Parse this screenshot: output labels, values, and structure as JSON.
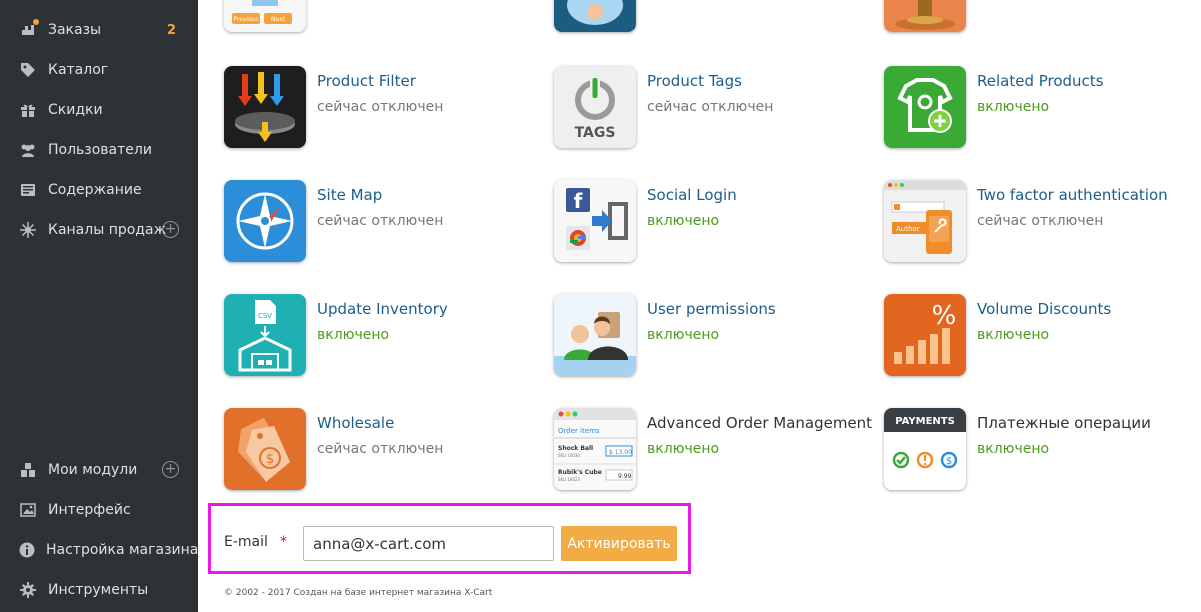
{
  "sidebar": {
    "items": [
      {
        "label": "Заказы",
        "icon": "orders-icon",
        "badge": "2"
      },
      {
        "label": "Каталог",
        "icon": "tag-icon"
      },
      {
        "label": "Скидки",
        "icon": "gift-icon"
      },
      {
        "label": "Пользователи",
        "icon": "users-icon"
      },
      {
        "label": "Содержание",
        "icon": "content-icon"
      },
      {
        "label": "Каналы продаж",
        "icon": "channels-icon"
      }
    ],
    "bottom_items": [
      {
        "label": "Мои модули",
        "icon": "modules-icon"
      },
      {
        "label": "Интерфейс",
        "icon": "image-icon"
      },
      {
        "label": "Настройка магазина",
        "icon": "info-icon"
      },
      {
        "label": "Инструменты",
        "icon": "gear-icon"
      }
    ]
  },
  "top_partial_tiles": {
    "pager_previous": "Previous",
    "pager_next": "Next"
  },
  "modules": [
    {
      "name": "Product Filter",
      "status": "сейчас отключен",
      "enabled": false,
      "icon": "product-filter-icon"
    },
    {
      "name": "Product Tags",
      "status": "сейчас отключен",
      "enabled": false,
      "icon": "product-tags-icon",
      "icon_text": "TAGS"
    },
    {
      "name": "Related Products",
      "status": "включено",
      "enabled": true,
      "icon": "related-products-icon"
    },
    {
      "name": "Site Map",
      "status": "сейчас отключен",
      "enabled": false,
      "icon": "compass-icon"
    },
    {
      "name": "Social Login",
      "status": "включено",
      "enabled": true,
      "icon": "social-login-icon"
    },
    {
      "name": "Two factor authentication",
      "status": "сейчас отключен",
      "enabled": false,
      "icon": "two-factor-icon",
      "icon_text": "Author"
    },
    {
      "name": "Update Inventory",
      "status": "включено",
      "enabled": true,
      "icon": "update-inventory-icon",
      "icon_text": "CSV"
    },
    {
      "name": "User permissions",
      "status": "включено",
      "enabled": true,
      "icon": "user-permissions-icon"
    },
    {
      "name": "Volume Discounts",
      "status": "включено",
      "enabled": true,
      "icon": "volume-discounts-icon",
      "icon_text": "%"
    },
    {
      "name": "Wholesale",
      "status": "сейчас отключен",
      "enabled": false,
      "icon": "wholesale-icon",
      "icon_text": "$"
    },
    {
      "name": "Advanced Order Management",
      "status": "включено",
      "enabled": true,
      "icon": "order-management-icon",
      "link": false,
      "icon_text": {
        "title": "Order items",
        "item1": "Shock Ball",
        "sku1": "SKU 10030",
        "price1": "$ 13.00",
        "item2": "Rubik's Cube",
        "sku2": "SKU 10023",
        "price2": "9.99"
      }
    },
    {
      "name": "Платежные операции",
      "status": "включено",
      "enabled": true,
      "icon": "payments-icon",
      "link": false,
      "icon_text": "PAYMENTS"
    }
  ],
  "activation_form": {
    "email_label": "E-mail",
    "required_mark": "*",
    "email_value": "anna@x-cart.com",
    "button_label": "Активировать"
  },
  "footer": {
    "copyright": "© 2002 - 2017 Создан на базе интернет магазина X-Cart"
  },
  "colors": {
    "sidebar_bg": "#2c3236",
    "link": "#1c5d8c",
    "enabled": "#4e9a1f",
    "disabled": "#777777",
    "button": "#f1ac45",
    "highlight_box": "#e619e6",
    "badge": "#f0a33a"
  }
}
